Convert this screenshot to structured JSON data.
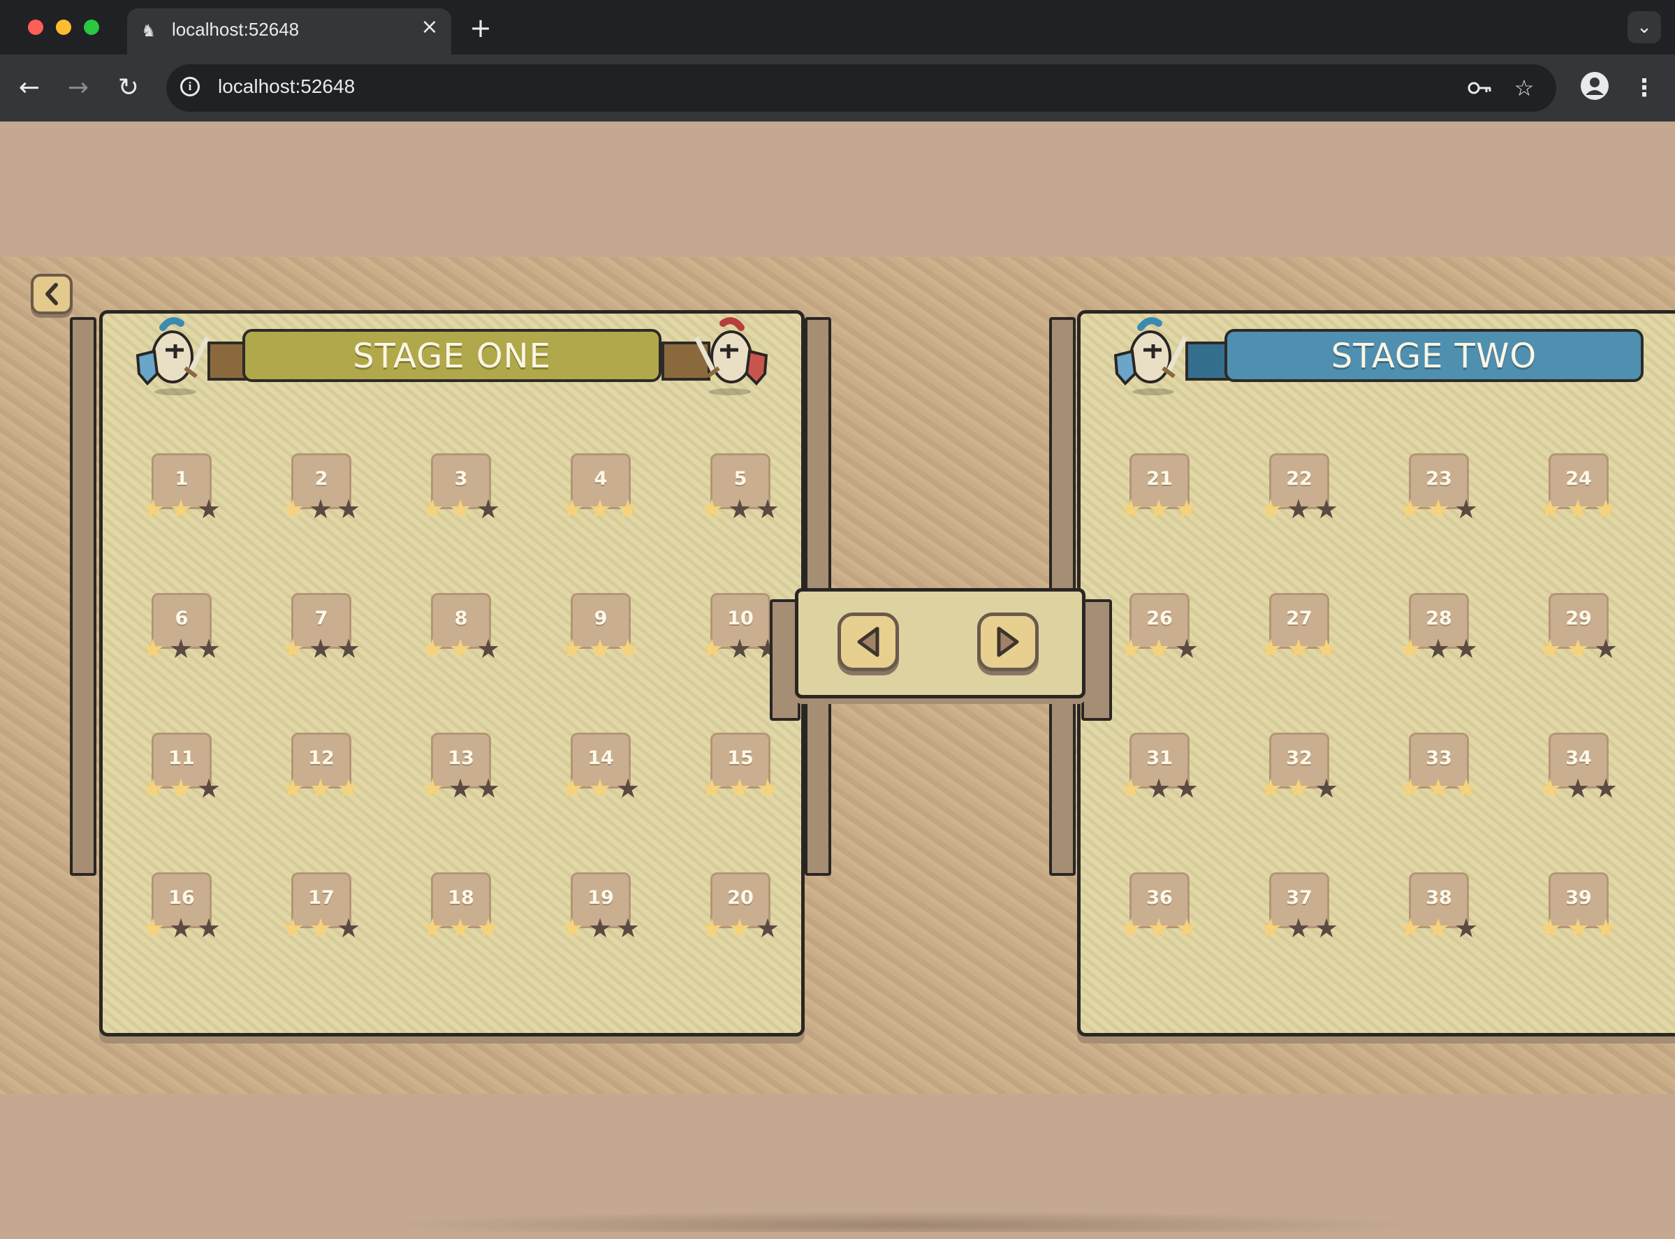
{
  "browser": {
    "tab_title": "localhost:52648",
    "url": "localhost:52648"
  },
  "stages": [
    {
      "title": "STAGE ONE",
      "ribbon_color": "#b0a84a",
      "levels": [
        {
          "number": "1",
          "stars": 2
        },
        {
          "number": "2",
          "stars": 1
        },
        {
          "number": "3",
          "stars": 2
        },
        {
          "number": "4",
          "stars": 3
        },
        {
          "number": "5",
          "stars": 1
        },
        {
          "number": "6",
          "stars": 1
        },
        {
          "number": "7",
          "stars": 1
        },
        {
          "number": "8",
          "stars": 2
        },
        {
          "number": "9",
          "stars": 3
        },
        {
          "number": "10",
          "stars": 1
        },
        {
          "number": "11",
          "stars": 2
        },
        {
          "number": "12",
          "stars": 3
        },
        {
          "number": "13",
          "stars": 1
        },
        {
          "number": "14",
          "stars": 2
        },
        {
          "number": "15",
          "stars": 3
        },
        {
          "number": "16",
          "stars": 1
        },
        {
          "number": "17",
          "stars": 2
        },
        {
          "number": "18",
          "stars": 3
        },
        {
          "number": "19",
          "stars": 1
        },
        {
          "number": "20",
          "stars": 2
        }
      ]
    },
    {
      "title": "STAGE TWO",
      "ribbon_color": "#4f8fb0",
      "levels": [
        {
          "number": "21",
          "stars": 3
        },
        {
          "number": "22",
          "stars": 1
        },
        {
          "number": "23",
          "stars": 2
        },
        {
          "number": "24",
          "stars": 3
        },
        {
          "number": "26",
          "stars": 2
        },
        {
          "number": "27",
          "stars": 3
        },
        {
          "number": "28",
          "stars": 1
        },
        {
          "number": "29",
          "stars": 2
        },
        {
          "number": "31",
          "stars": 1
        },
        {
          "number": "32",
          "stars": 2
        },
        {
          "number": "33",
          "stars": 3
        },
        {
          "number": "34",
          "stars": 1
        },
        {
          "number": "36",
          "stars": 3
        },
        {
          "number": "37",
          "stars": 1
        },
        {
          "number": "38",
          "stars": 2
        },
        {
          "number": "39",
          "stars": 3
        }
      ]
    }
  ],
  "colors": {
    "background": "#c4a990",
    "panel": "#ddd3a1",
    "star_on": "#f6d27a",
    "star_off": "#5a4a42"
  },
  "icons": {
    "back": "chevron-left-icon",
    "prev_stage": "triangle-left-icon",
    "next_stage": "triangle-right-icon"
  }
}
